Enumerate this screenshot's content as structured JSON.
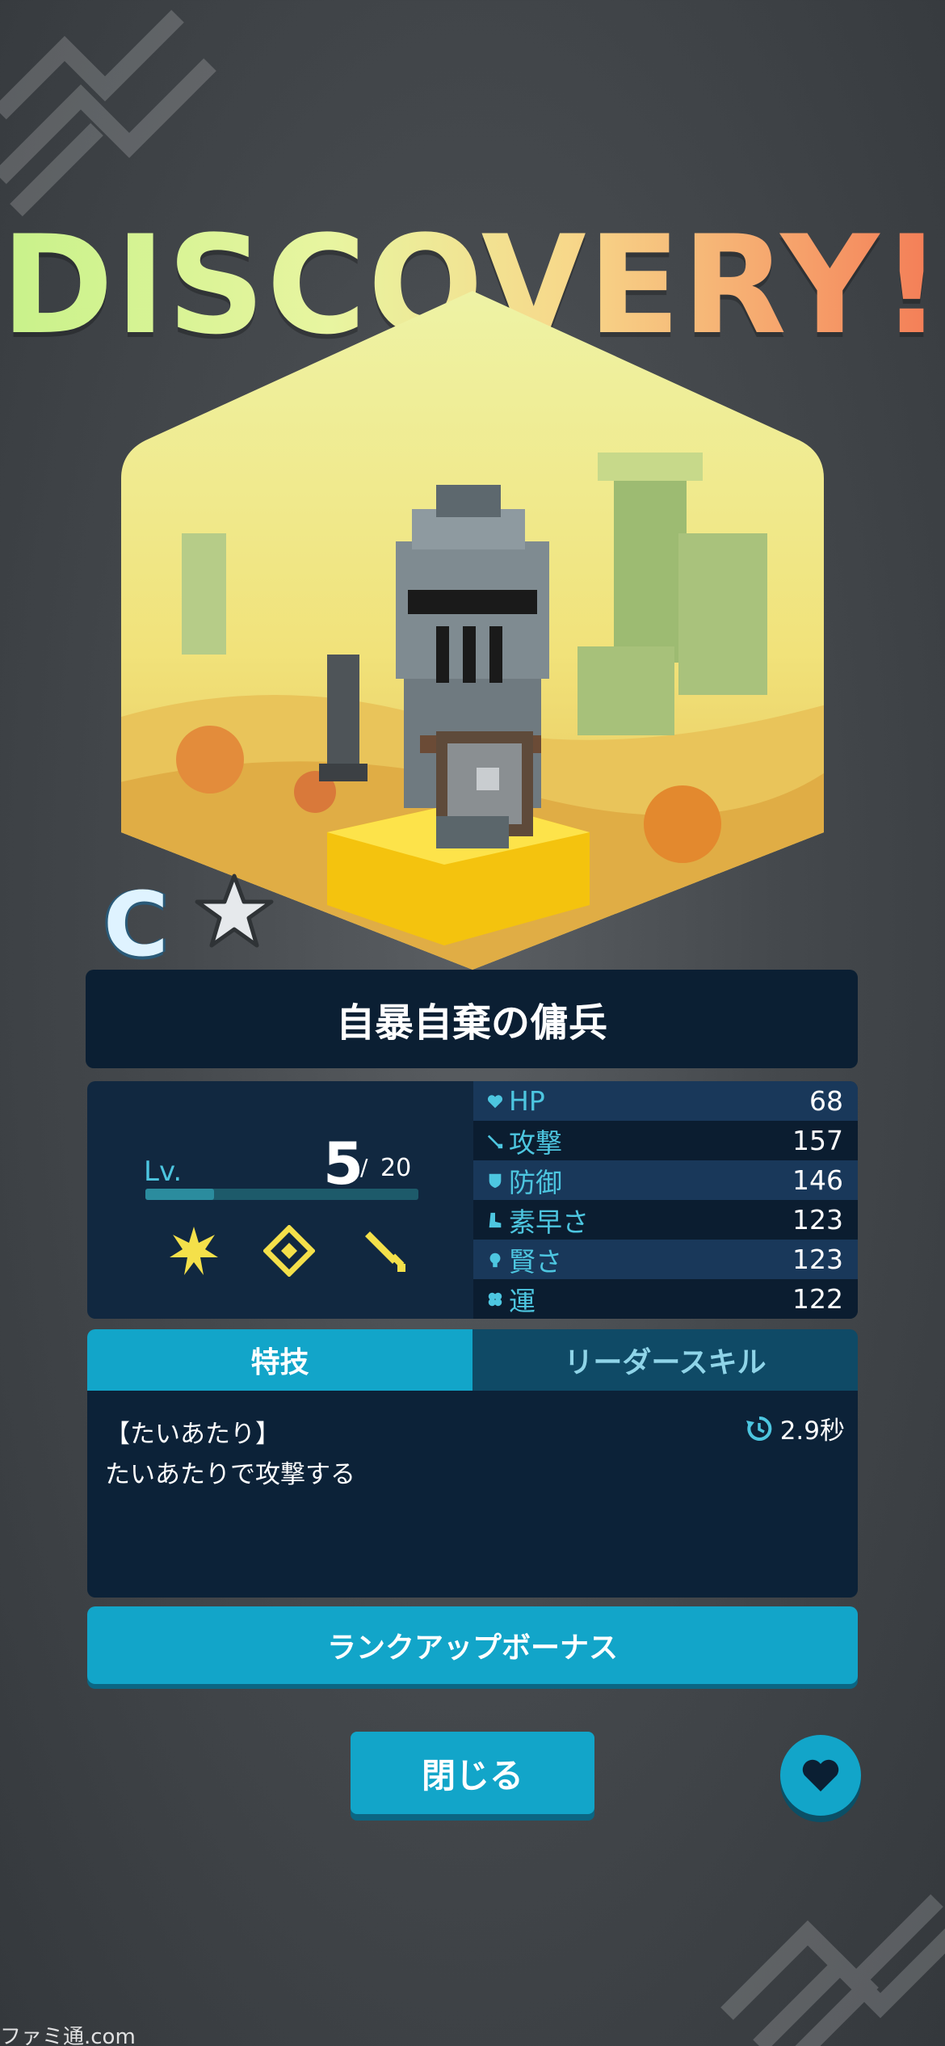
{
  "header": {
    "title": "DISCOVERY!"
  },
  "character": {
    "rank": "C",
    "name": "自暴自棄の傭兵"
  },
  "level": {
    "label": "Lv.",
    "current": "5",
    "separator": "/",
    "max": "20",
    "progress": 0.25
  },
  "stats": [
    {
      "name": "HP",
      "value": "68",
      "icon": "heart-icon"
    },
    {
      "name": "攻撃",
      "value": "157",
      "icon": "sword-icon"
    },
    {
      "name": "防御",
      "value": "146",
      "icon": "shield-icon"
    },
    {
      "name": "素早さ",
      "value": "123",
      "icon": "boot-icon"
    },
    {
      "name": "賢さ",
      "value": "123",
      "icon": "bulb-icon"
    },
    {
      "name": "運",
      "value": "122",
      "icon": "clover-icon"
    }
  ],
  "attribute_icons": [
    "burst-icon",
    "diamond-icon",
    "sword-icon"
  ],
  "tabs": [
    {
      "label": "特技",
      "active": true
    },
    {
      "label": "リーダースキル",
      "active": false
    }
  ],
  "skill": {
    "title": "【たいあたり】",
    "description": "たいあたりで攻撃する",
    "cooldown": "2.9秒"
  },
  "buttons": {
    "rank_up": "ランクアップボーナス",
    "close": "閉じる"
  },
  "watermark": "ファミ通.com",
  "colors": {
    "accent": "#12a5c9",
    "panel_dark": "#0b1f33",
    "stat_label": "#4dc6e0",
    "attribute_yellow": "#f4e04a"
  }
}
